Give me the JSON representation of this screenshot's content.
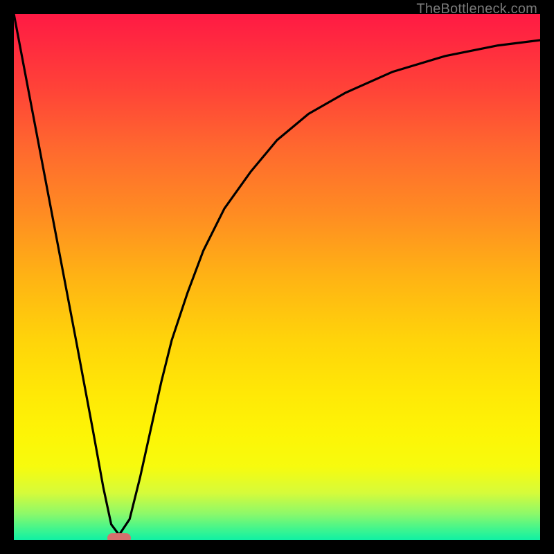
{
  "watermark": "TheBottleneck.com",
  "chart_data": {
    "type": "line",
    "title": "",
    "xlabel": "",
    "ylabel": "",
    "xlim": [
      0,
      100
    ],
    "ylim": [
      0,
      100
    ],
    "x": [
      0,
      4,
      8,
      12,
      15,
      17,
      18.5,
      20,
      22,
      24,
      26,
      28,
      30,
      33,
      36,
      40,
      45,
      50,
      56,
      63,
      72,
      82,
      92,
      100
    ],
    "values": [
      100,
      79,
      58,
      37,
      21,
      10,
      3,
      1,
      4,
      12,
      21,
      30,
      38,
      47,
      55,
      63,
      70,
      76,
      81,
      85,
      89,
      92,
      94,
      95
    ],
    "grid": false,
    "legend_position": "none",
    "minimum_marker": {
      "x": 20,
      "y": 0
    }
  },
  "gradient": {
    "top": "#ff1a44",
    "upper_mid": "#ff8c22",
    "mid": "#ffe806",
    "lower_mid": "#d6fb3a",
    "bottom": "#0ff0a4"
  }
}
